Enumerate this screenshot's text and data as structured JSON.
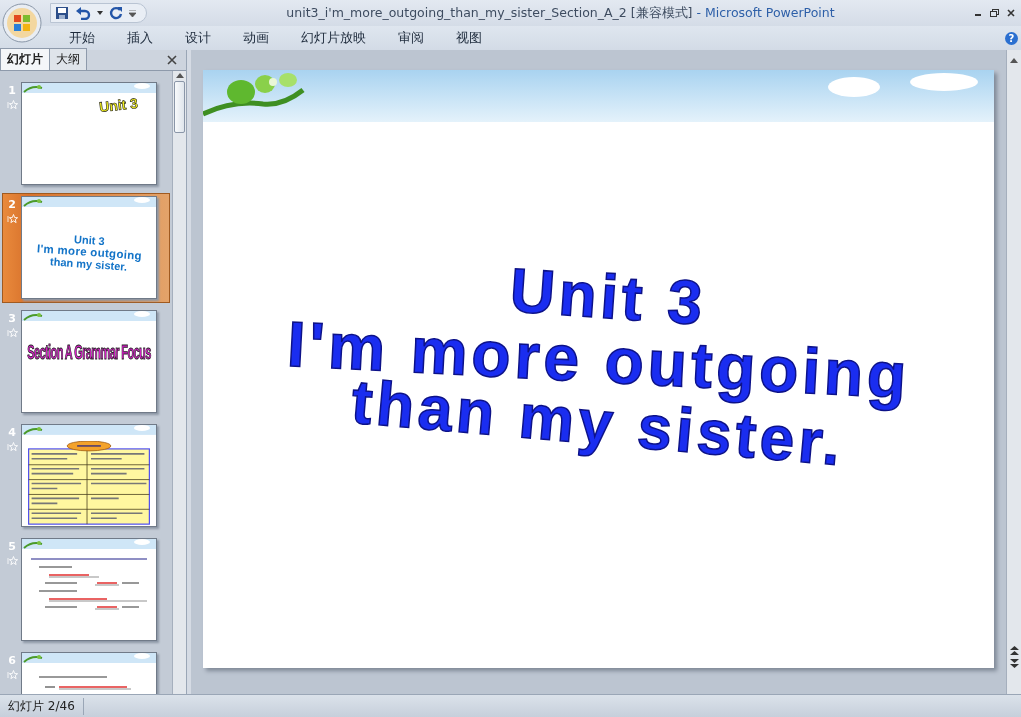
{
  "window": {
    "title": "unit3_i'm_more_outgoing_than_my_sister_Section_A_2 [兼容模式]",
    "app_name": "- Microsoft PowerPoint"
  },
  "ribbon_tabs": [
    {
      "label": "开始",
      "selected": false
    },
    {
      "label": "插入",
      "selected": false
    },
    {
      "label": "设计",
      "selected": false
    },
    {
      "label": "动画",
      "selected": false
    },
    {
      "label": "幻灯片放映",
      "selected": false
    },
    {
      "label": "审阅",
      "selected": false
    },
    {
      "label": "视图",
      "selected": false
    }
  ],
  "help_label": "?",
  "panel_tabs": [
    {
      "label": "幻灯片",
      "selected": true
    },
    {
      "label": "大纲",
      "selected": false
    }
  ],
  "slides": [
    {
      "number": "1",
      "selected": false,
      "kind": "corner-title",
      "lines": [
        "Unit 3"
      ]
    },
    {
      "number": "2",
      "selected": true,
      "kind": "wave-title",
      "lines": [
        "Unit 3",
        "I'm more outgoing",
        "than my sister."
      ]
    },
    {
      "number": "3",
      "selected": false,
      "kind": "banner-title",
      "lines": [
        "Section A Grammar Focus"
      ]
    },
    {
      "number": "4",
      "selected": false,
      "kind": "table"
    },
    {
      "number": "5",
      "selected": false,
      "kind": "exercise"
    },
    {
      "number": "6",
      "selected": false,
      "kind": "exercise-short"
    }
  ],
  "current_slide": {
    "lines": [
      "Unit 3",
      "I'm more outgoing",
      "than my sister."
    ]
  },
  "status_bar": {
    "slide_counter": "幻灯片 2/46"
  }
}
